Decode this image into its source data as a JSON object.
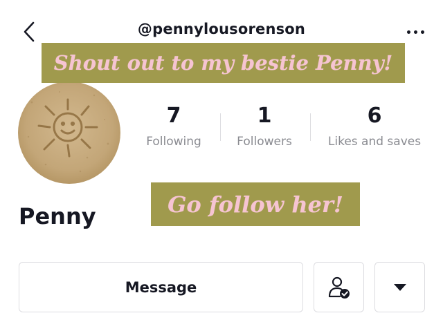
{
  "header": {
    "username": "@pennylousorenson",
    "back_icon": "chevron-left-icon",
    "more_icon": "more-horizontal-icon"
  },
  "overlays": {
    "banner_top": "Shout out to my bestie Penny!",
    "banner_bottom": "Go follow her!",
    "banner_color": "#a09a4d",
    "banner_text_color": "#f6c4d2"
  },
  "profile": {
    "display_name": "Penny",
    "avatar": "sun-drawing-in-sand",
    "stats": [
      {
        "value": "7",
        "label": "Following"
      },
      {
        "value": "1",
        "label": "Followers"
      },
      {
        "value": "6",
        "label": "Likes and saves"
      }
    ]
  },
  "actions": {
    "message_label": "Message",
    "friend_icon": "user-check-icon",
    "dropdown_icon": "caret-down-icon"
  }
}
